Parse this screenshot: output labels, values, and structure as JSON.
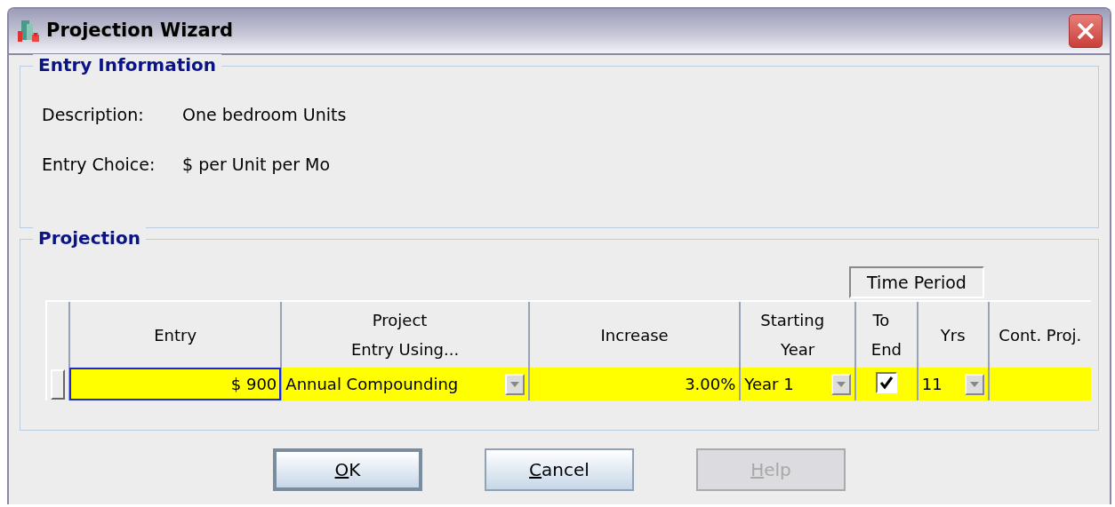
{
  "window": {
    "title": "Projection Wizard"
  },
  "entry_information": {
    "legend": "Entry Information",
    "fields": [
      {
        "label": "Description:",
        "value": "One bedroom Units"
      },
      {
        "label": "Entry Choice:",
        "value": "$ per Unit per Mo"
      }
    ]
  },
  "projection": {
    "legend": "Projection",
    "group_header": "Time Period",
    "columns": [
      {
        "lines": [
          "Entry"
        ]
      },
      {
        "lines": [
          "Project",
          "Entry Using..."
        ]
      },
      {
        "lines": [
          "Increase"
        ]
      },
      {
        "lines": [
          "Starting",
          "Year"
        ]
      },
      {
        "lines": [
          "To",
          "End"
        ]
      },
      {
        "lines": [
          "Yrs"
        ]
      },
      {
        "lines": [
          "Cont. Proj."
        ]
      }
    ],
    "rows": [
      {
        "cells": [
          {
            "kind": "number",
            "value": "$ 900",
            "focused": true
          },
          {
            "kind": "dropdown",
            "value": "Annual Compounding"
          },
          {
            "kind": "number",
            "value": "3.00%"
          },
          {
            "kind": "dropdown",
            "value": "Year 1"
          },
          {
            "kind": "checkbox",
            "checked": true
          },
          {
            "kind": "dropdown",
            "value": "11"
          },
          {
            "kind": "empty"
          }
        ]
      }
    ]
  },
  "buttons": [
    {
      "label": "OK",
      "underline_first": true,
      "disabled": false,
      "default": true
    },
    {
      "label": "Cancel",
      "underline_first": true,
      "disabled": false,
      "default": false
    },
    {
      "label": "Help",
      "underline_first": true,
      "disabled": true,
      "default": false
    }
  ]
}
